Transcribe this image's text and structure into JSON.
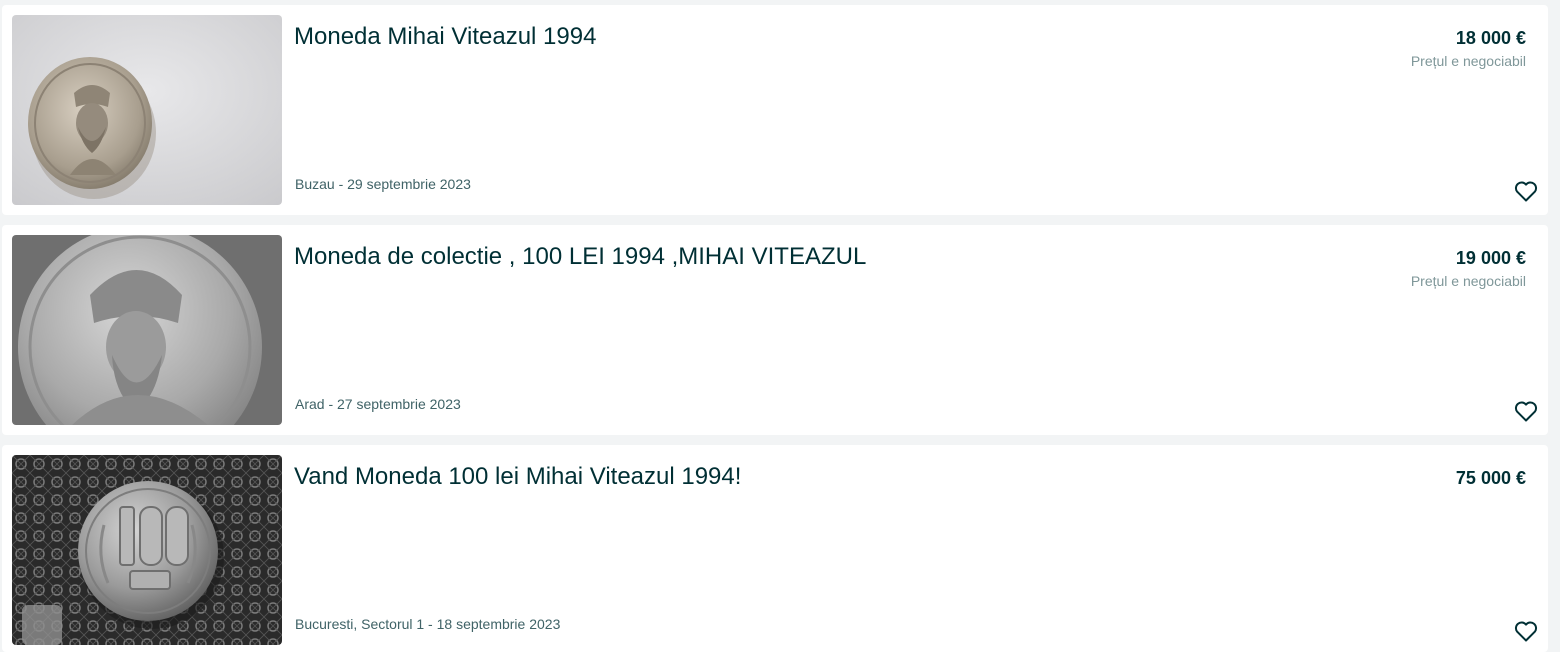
{
  "listings": [
    {
      "title": "Moneda Mihai Viteazul 1994",
      "location_date": "Buzau - 29 septembrie 2023",
      "price": "18 000 €",
      "negotiable": "Prețul e negociabil",
      "favorite_icon": "heart-icon"
    },
    {
      "title": "Moneda de colectie , 100 LEI 1994 ,MIHAI VITEAZUL",
      "location_date": "Arad - 27 septembrie 2023",
      "price": "19 000 €",
      "negotiable": "Prețul e negociabil",
      "favorite_icon": "heart-icon"
    },
    {
      "title": "Vand Moneda 100 lei Mihai Viteazul 1994!",
      "location_date": "Bucuresti, Sectorul 1 - 18 septembrie 2023",
      "price": "75 000 €",
      "negotiable": "",
      "favorite_icon": "heart-icon"
    }
  ],
  "colors": {
    "title": "#002f34",
    "secondary_text": "#406367",
    "muted_text": "#7f9799",
    "page_background": "#f2f4f5",
    "card_background": "#ffffff"
  }
}
